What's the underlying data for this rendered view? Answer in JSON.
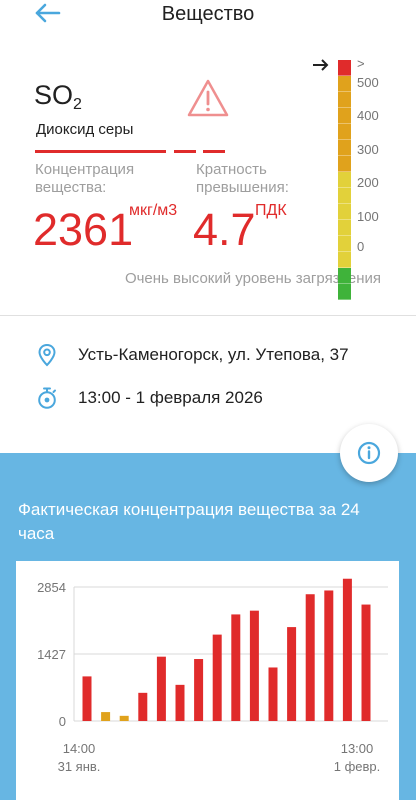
{
  "header": {
    "title": "Вещество",
    "back_icon": "arrow-left-icon"
  },
  "substance": {
    "formula_main": "SO",
    "formula_sub": "2",
    "name": "Диоксид серы",
    "warning_icon": "warning-triangle-icon",
    "concentration_label_1": "Концентрация",
    "concentration_label_2": "вещества:",
    "concentration_value": "2361",
    "concentration_unit": "мкг/м3",
    "excess_label_1": "Кратность",
    "excess_label_2": "превышения:",
    "excess_value": "4.7",
    "excess_unit": "ПДК",
    "level_text": "Очень высокий уровень загрязнения",
    "accent_color": "#e02b2b"
  },
  "scale": {
    "labels": [
      ">",
      "500",
      "400",
      "300",
      "200",
      "100",
      "0"
    ],
    "segment_colors": [
      "#e02b2b",
      "#e0a21c",
      "#e0a21c",
      "#e0a21c",
      "#e0a21c",
      "#e0a21c",
      "#e0a21c",
      "#e2d13a",
      "#e2d13a",
      "#e2d13a",
      "#e2d13a",
      "#e2d13a",
      "#e2d13a",
      "#3fb33a",
      "#3fb33a"
    ],
    "current_segment": 0,
    "arrow_icon": "arrow-right-icon"
  },
  "location": {
    "icon": "location-pin-icon",
    "text": "Усть-Каменогорск, ул. Утепова, 37"
  },
  "time": {
    "icon": "stopwatch-icon",
    "text": "13:00 - 1 февраля 2026"
  },
  "info_button": {
    "icon": "info-icon"
  },
  "chart_panel": {
    "title": "Фактическая концентрация вещества за 24 часа",
    "background": "#67b6e3"
  },
  "chart_data": {
    "type": "bar",
    "title": "",
    "xlabel": "",
    "ylabel": "",
    "ylim": [
      0,
      2854
    ],
    "yticks": [
      0,
      1427,
      2854
    ],
    "ytick_labels": [
      "0",
      "1427",
      "2854"
    ],
    "x_start_label": [
      "14:00",
      "31 янв."
    ],
    "x_end_label": [
      "13:00",
      "1 февр."
    ],
    "grid": true,
    "values": [
      950,
      190,
      110,
      600,
      1370,
      770,
      1320,
      1840,
      2270,
      2350,
      1140,
      2000,
      2700,
      2780,
      3030,
      2480
    ],
    "colors": [
      "#e02b2b",
      "#e0a21c",
      "#e0a21c",
      "#e02b2b",
      "#e02b2b",
      "#e02b2b",
      "#e02b2b",
      "#e02b2b",
      "#e02b2b",
      "#e02b2b",
      "#e02b2b",
      "#e02b2b",
      "#e02b2b",
      "#e02b2b",
      "#e02b2b",
      "#e02b2b"
    ]
  }
}
